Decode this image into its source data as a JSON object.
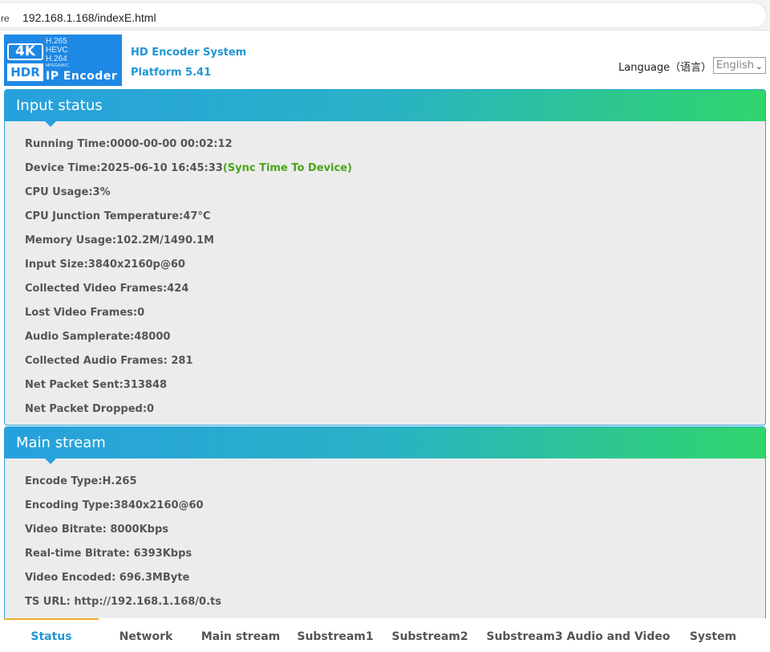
{
  "browser": {
    "url_prefix": "re",
    "url": "192.168.1.168/indexE.html"
  },
  "logo": {
    "badge_4k": "4K",
    "badge_hdr": "HDR",
    "codecs": [
      "H.265",
      "HEVC",
      "H.264"
    ],
    "codec_small": "MPEG4/AVC",
    "product": "IP Encoder"
  },
  "header": {
    "system_name": "HD Encoder System",
    "platform": "Platform 5.41",
    "language_label": "Language（语言）",
    "language_value": "English"
  },
  "input_status": {
    "title": "Input status",
    "rows": [
      "Running Time:0000-00-00 00:02:12",
      "Device Time:2025-06-10 16:45:33",
      "CPU Usage:3%",
      "CPU Junction Temperature:47°C",
      "Memory Usage:102.2M/1490.1M",
      "Input Size:3840x2160p@60",
      "Collected Video Frames:424",
      "Lost Video Frames:0",
      "Audio Samplerate:48000",
      "Collected Audio Frames: 281",
      "Net Packet Sent:313848",
      "Net Packet Dropped:0"
    ],
    "sync_link": "(Sync Time To Device)"
  },
  "main_stream": {
    "title": "Main stream",
    "rows": [
      "Encode Type:H.265",
      "Encoding Type:3840x2160@60",
      "Video Bitrate: 8000Kbps",
      "Real-time Bitrate: 6393Kbps",
      "Video Encoded: 696.3MByte",
      "TS URL: http://192.168.1.168/0.ts"
    ]
  },
  "nav": {
    "active": "Status",
    "items": [
      "Status",
      "Network",
      "Main stream",
      "Substream1",
      "Substream2",
      "Substream3",
      "Audio and Video",
      "System"
    ]
  },
  "colors": {
    "accent": "#2196d3",
    "header_gradient_start": "#27a0de",
    "header_gradient_end": "#30d56c",
    "sync_link": "#4aa51a",
    "nav_active_border": "#f0b030"
  }
}
